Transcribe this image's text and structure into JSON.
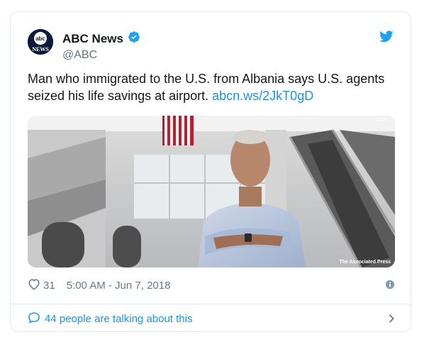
{
  "tweet": {
    "author_name": "ABC News",
    "handle": "@ABC",
    "avatar_text_top": "abc",
    "avatar_text_bottom": "NEWS",
    "text": "Man who immigrated to the U.S. from Albania says U.S. agents seized his life savings at airport.",
    "link_text": "abcn.ws/2JkT0gD",
    "media_credit": "The Associated Press",
    "likes": "31",
    "timestamp": "5:00 AM - Jun 7, 2018",
    "talking": "44 people are talking about this"
  },
  "colors": {
    "link": "#1b95e0",
    "verified": "#1da1f2",
    "muted": "#657786",
    "border": "#e1e8ed"
  },
  "icons": {
    "verified": "verified-badge-icon",
    "bird": "twitter-bird-icon",
    "heart": "heart-icon",
    "info": "info-icon",
    "comment": "comment-bubble-icon",
    "chevron": "chevron-right-icon"
  }
}
